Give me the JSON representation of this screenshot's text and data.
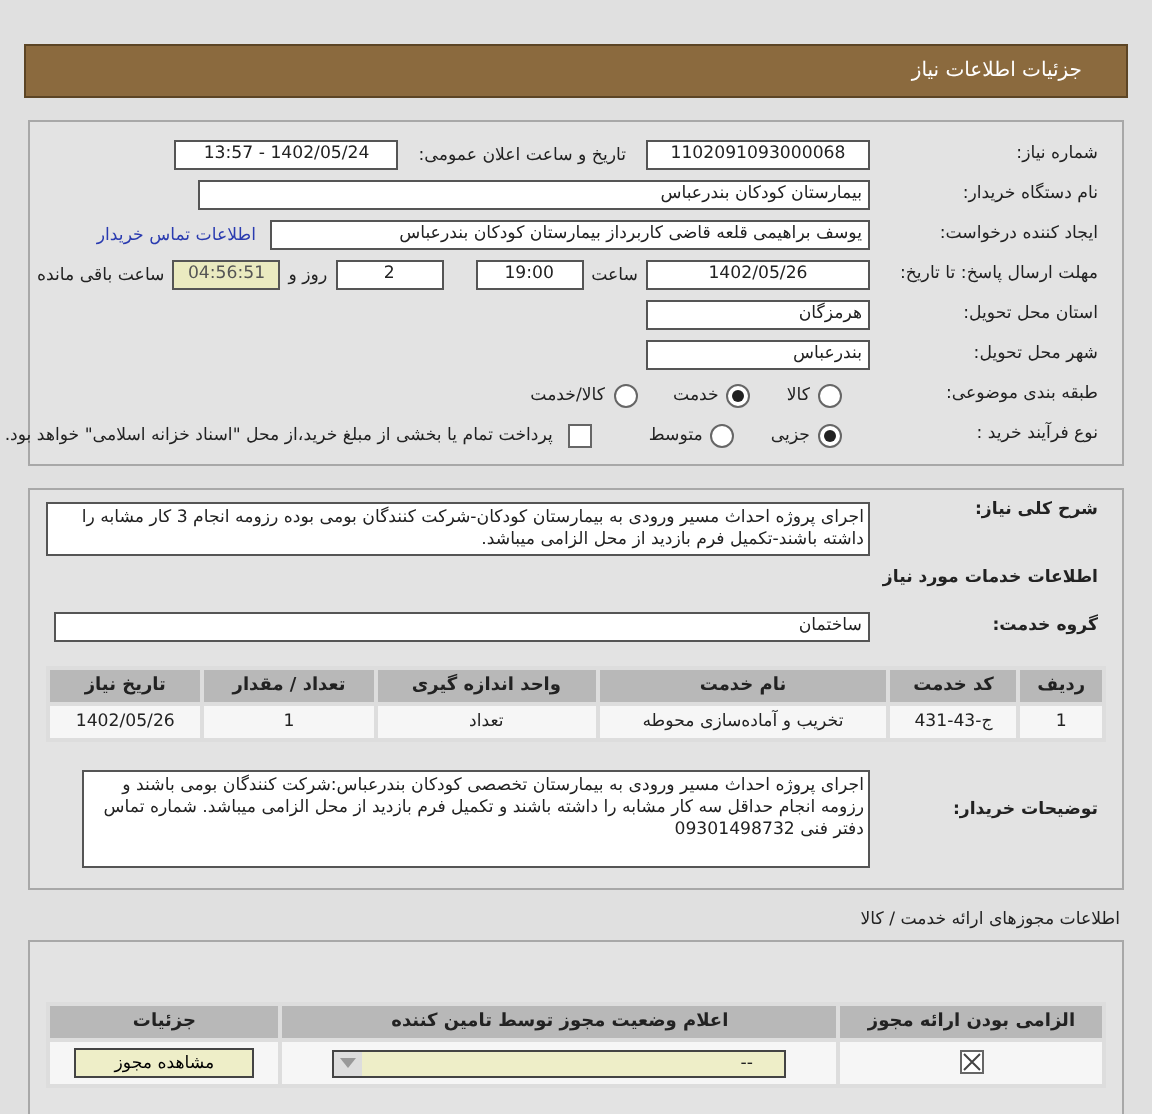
{
  "header": {
    "title": "جزئیات اطلاعات نیاز"
  },
  "need_number": {
    "label": "شماره نیاز:",
    "value": "1102091093000068"
  },
  "announce": {
    "label": "تاریخ و ساعت اعلان عمومی:",
    "value": "1402/05/24 - 13:57"
  },
  "buyer": {
    "label": "نام دستگاه خریدار:",
    "value": "بیمارستان کودکان بندرعباس"
  },
  "requester": {
    "label": "ایجاد کننده درخواست:",
    "value": "یوسف براهیمی قلعه قاضی کاربرداز بیمارستان کودکان بندرعباس",
    "link": "اطلاعات تماس خریدار"
  },
  "deadline": {
    "label": "مهلت ارسال پاسخ: تا تاریخ:",
    "date": "1402/05/26",
    "time_label": "ساعت",
    "time": "19:00",
    "days": "2",
    "days_label": "روز و",
    "remaining": "04:56:51",
    "remaining_label": "ساعت باقی مانده"
  },
  "province": {
    "label": "استان محل تحویل:",
    "value": "هرمزگان"
  },
  "city": {
    "label": "شهر محل تحویل:",
    "value": "بندرعباس"
  },
  "category": {
    "label": "طبقه بندی موضوعی:",
    "options": [
      {
        "label": "کالا",
        "selected": false
      },
      {
        "label": "خدمت",
        "selected": true
      },
      {
        "label": "کالا/خدمت",
        "selected": false
      }
    ]
  },
  "process": {
    "label": "نوع فرآیند خرید :",
    "options": [
      {
        "label": "جزیی",
        "selected": true
      },
      {
        "label": "متوسط",
        "selected": false
      }
    ],
    "payment": {
      "label": "پرداخت تمام یا بخشی از مبلغ خرید،از محل \"اسناد خزانه اسلامی\" خواهد بود.",
      "checked": false
    }
  },
  "description": {
    "label": "شرح کلی نیاز:",
    "value": "اجرای پروژه احداث مسیر ورودی به بیمارستان کودکان-شرکت کنندگان بومی بوده رزومه انجام 3 کار مشابه را داشته باشند-تکمیل فرم بازدید از محل الزامی میباشد."
  },
  "services_title": "اطلاعات خدمات مورد نیاز",
  "service_group": {
    "label": "گروه خدمت:",
    "value": "ساختمان"
  },
  "services_table": {
    "columns": [
      "ردیف",
      "کد خدمت",
      "نام خدمت",
      "واحد اندازه گیری",
      "تعداد / مقدار",
      "تاریخ نیاز"
    ],
    "rows": [
      [
        "1",
        "ج-43-431",
        "تخریب و آماده‌سازی محوطه",
        "تعداد",
        "1",
        "1402/05/26"
      ]
    ]
  },
  "buyer_notes": {
    "label": "توضیحات خریدار:",
    "value": "اجرای پروژه احداث مسیر ورودی به بیمارستان تخصصی کودکان بندرعباس:شرکت کنندگان بومی باشند و رزومه انجام  حداقل سه کار مشابه را داشته باشند و تکمیل فرم بازدید از محل الزامی میباشد. شماره تماس دفتر فنی 09301498732"
  },
  "licenses_title": "اطلاعات مجوزهای ارائه خدمت / کالا",
  "licenses_table": {
    "columns": [
      "الزامی بودن ارائه مجوز",
      "اعلام وضعیت مجوز توسط تامین کننده",
      "جزئیات"
    ],
    "rows": [
      {
        "required": true,
        "status": "--",
        "button": "مشاهده مجوز"
      }
    ]
  }
}
